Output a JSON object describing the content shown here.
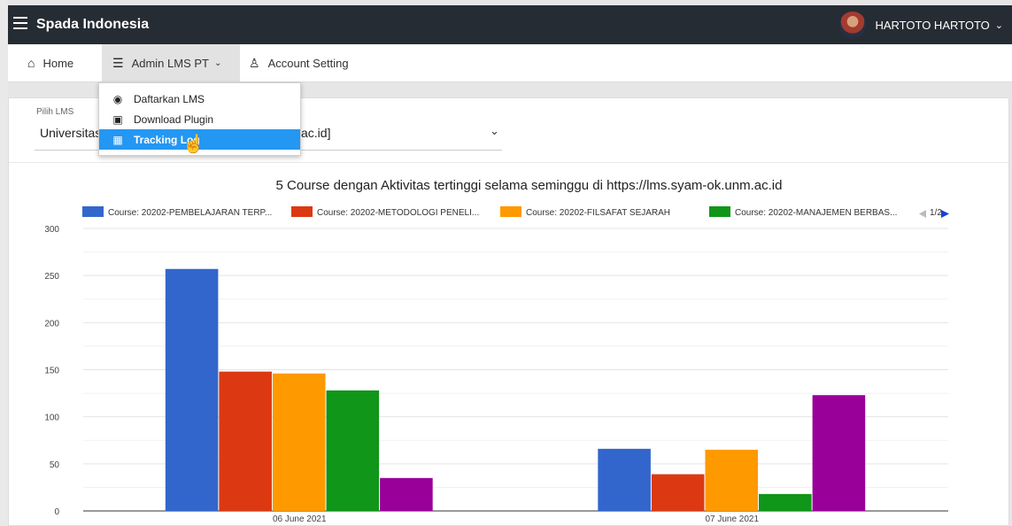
{
  "app": {
    "title": "Spada Indonesia",
    "user_name": "HARTOTO HARTOTO"
  },
  "nav": {
    "home": "Home",
    "admin": "Admin LMS PT",
    "account": "Account Setting"
  },
  "dropdown": {
    "items": [
      {
        "label": "Daftarkan LMS",
        "icon": "medal-icon"
      },
      {
        "label": "Download Plugin",
        "icon": "plugin-icon"
      },
      {
        "label": "Tracking Log",
        "icon": "log-icon"
      }
    ]
  },
  "selector": {
    "label": "Pilih LMS",
    "value_start": "Universitas",
    "value_end": "ac.id]"
  },
  "colors": {
    "topbar": "#262c33",
    "accent": "#2497f3"
  },
  "chart_data": {
    "type": "bar",
    "title": "5 Course dengan Aktivitas tertinggi selama seminggu di https://lms.syam-ok.unm.ac.id",
    "categories": [
      "06 June 2021",
      "07 June 2021"
    ],
    "ylim": [
      0,
      300
    ],
    "yticks": [
      0,
      50,
      100,
      150,
      200,
      250,
      300
    ],
    "legend_page": "1/2",
    "legend_position": "top",
    "grid": true,
    "series": [
      {
        "name": "Course: 20202-PEMBELAJARAN TERP...",
        "color": "#3366cc",
        "values": [
          257,
          66
        ]
      },
      {
        "name": "Course: 20202-METODOLOGI PENELI...",
        "color": "#dc3912",
        "values": [
          148,
          39
        ]
      },
      {
        "name": "Course: 20202-FILSAFAT SEJARAH",
        "color": "#ff9900",
        "values": [
          146,
          65
        ]
      },
      {
        "name": "Course: 20202-MANAJEMEN BERBAS...",
        "color": "#109618",
        "values": [
          128,
          18
        ]
      },
      {
        "color": "#990099",
        "values": [
          35,
          123
        ]
      }
    ]
  }
}
